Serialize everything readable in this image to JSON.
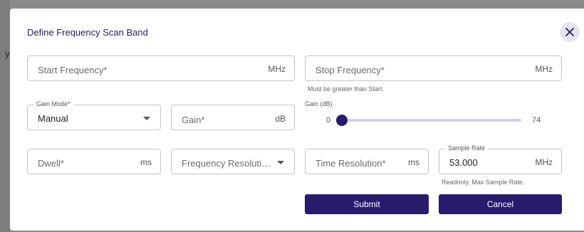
{
  "backdrop": {
    "glyph": "y"
  },
  "dialog": {
    "title": "Define Frequency Scan Band",
    "close_icon": "close-icon"
  },
  "start_frequency": {
    "placeholder": "Start Frequency*",
    "unit": "MHz"
  },
  "stop_frequency": {
    "placeholder": "Stop Frequency*",
    "unit": "MHz",
    "helper": "Must be greater than Start."
  },
  "gain_mode": {
    "legend": "Gain Mode*",
    "selected": "Manual"
  },
  "gain": {
    "placeholder": "Gain*",
    "unit": "dB"
  },
  "gain_slider": {
    "label": "Gain (dB)",
    "min_label": "0",
    "max_label": "74",
    "value": 0,
    "min": 0,
    "max": 74
  },
  "dwell": {
    "placeholder": "Dwell*",
    "unit": "ms"
  },
  "frequency_resolution": {
    "placeholder": "Frequency Resoluti…"
  },
  "time_resolution": {
    "placeholder": "Time Resolution*",
    "unit": "ms"
  },
  "sample_rate": {
    "legend": "Sample Rate",
    "value": "53.000",
    "unit": "MHz",
    "helper": "Readonly. Max Sample Rate."
  },
  "actions": {
    "submit_label": "Submit",
    "cancel_label": "Cancel"
  },
  "colors": {
    "primary": "#2a1a6e",
    "title": "#2a1a5e",
    "close_bg": "#e7e3ee",
    "slider_track": "#d6d0e6"
  }
}
